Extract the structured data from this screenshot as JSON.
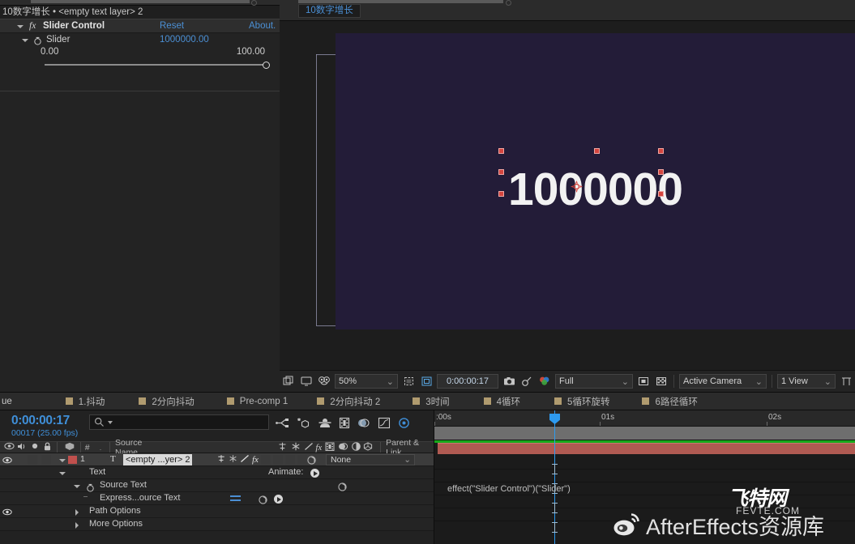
{
  "effect_controls": {
    "panel_header": "10数字增长 • <empty text layer> 2",
    "effect_name": "Slider Control",
    "fx_badge": "fx",
    "reset_label": "Reset",
    "about_label": "About.",
    "property_name": "Slider",
    "property_value": "1000000.00",
    "slider_min": "0.00",
    "slider_max": "100.00",
    "icons": {
      "disclosure": "chevron-down-icon",
      "stopwatch": "stopwatch-icon"
    }
  },
  "composition": {
    "tab_label": "10数字增长",
    "tab_color": "#4b8fd4",
    "background_color": "#231c38",
    "rendered_text": "1000000",
    "text_color": "#f2f2f2",
    "selection_color": "#d4453f"
  },
  "viewer_toolbar": {
    "zoom_level": "50%",
    "timecode": "0:00:00:17",
    "resolution": "Full",
    "camera": "Active Camera",
    "views": "1 View",
    "icons": [
      "always-preview-icon",
      "monitor-icon",
      "mask-visibility-icon",
      "region-of-interest-icon",
      "title-action-safe-icon",
      "snapshot-icon",
      "show-snapshot-icon",
      "channel-rgb-icon",
      "transparency-grid-icon",
      "toggle-alpha-icon",
      "guides-icon",
      "fast-preview-icon",
      "timeline-graph-icon"
    ]
  },
  "timeline_tabs": [
    {
      "label": "ue",
      "has_square": false
    },
    {
      "label": "1.抖动",
      "has_square": true
    },
    {
      "label": "2分向抖动",
      "has_square": true
    },
    {
      "label": "Pre-comp 1",
      "has_square": true
    },
    {
      "label": "2分向抖动 2",
      "has_square": true
    },
    {
      "label": "3时间",
      "has_square": true
    },
    {
      "label": "4循环",
      "has_square": true
    },
    {
      "label": "5循环旋转",
      "has_square": true
    },
    {
      "label": "6路径循环",
      "has_square": true
    }
  ],
  "timeline": {
    "timecode": "0:00:00:17",
    "frame_info": "00017 (25.00 fps)",
    "search_placeholder": "",
    "search_value": "",
    "column_headers": {
      "source_name": "Source Name",
      "parent_link": "Parent & Link",
      "hash": "#"
    },
    "ruler_ticks": [
      ":00s",
      "01s",
      "02s"
    ],
    "layers": [
      {
        "number": "1",
        "type_glyph": "T",
        "name": "<empty ...yer> 2",
        "label_color": "#c0504d",
        "parent": "None",
        "selected": true
      }
    ],
    "properties": [
      {
        "indent": 0,
        "label": "Text",
        "extra": "Animate:",
        "disclosure": "open"
      },
      {
        "indent": 1,
        "label": "Source Text",
        "disclosure": "open"
      },
      {
        "indent": 2,
        "label": "Express...ource Text",
        "disclosure": "none"
      },
      {
        "indent": 1,
        "label": "Path Options",
        "disclosure": "closed"
      },
      {
        "indent": 1,
        "label": "More Options",
        "disclosure": "closed"
      }
    ],
    "expression": "effect(\"Slider Control\")(\"Slider\")",
    "layer_bar_color": "#b05a52",
    "keyframe_line_color": "#17a81a"
  },
  "watermark": {
    "logo_text": "飞特网",
    "logo_sub": "FEVTE.COM",
    "bottom_text": "AfterEffects资源库"
  }
}
